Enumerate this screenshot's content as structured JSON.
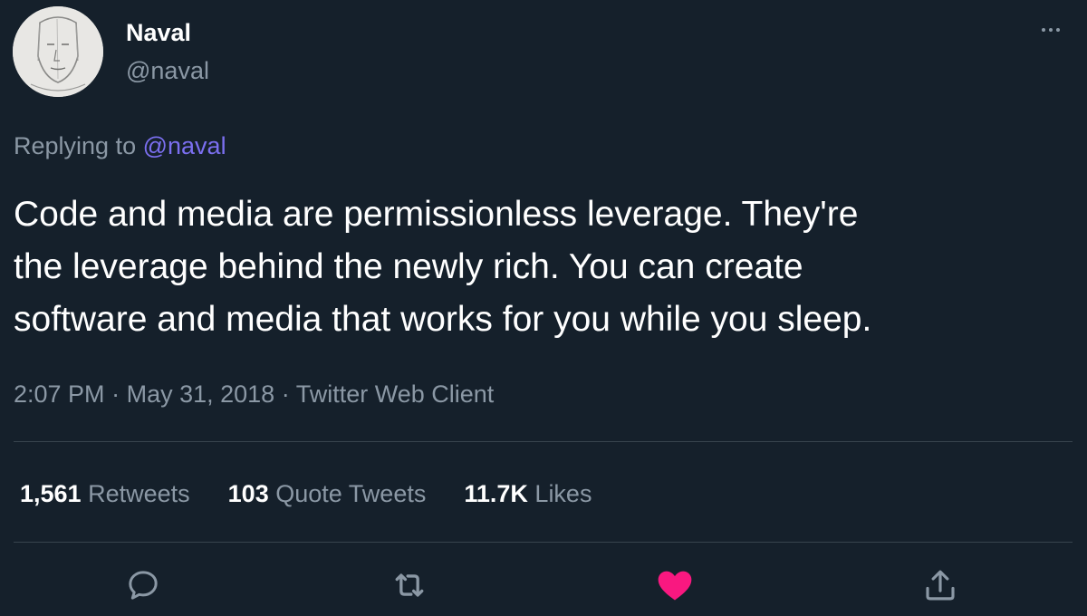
{
  "author": {
    "name": "Naval",
    "handle": "@naval"
  },
  "reply": {
    "prefix": "Replying to",
    "mention": "@naval"
  },
  "tweet": {
    "lines": [
      "Code and media are permissionless leverage. They're",
      "the leverage behind the newly rich. You can create",
      "software and media that works for you while you sleep."
    ],
    "time": "2:07 PM",
    "date": "May 31, 2018",
    "client": "Twitter Web Client",
    "separator": "·"
  },
  "stats": {
    "retweets": {
      "count": "1,561",
      "label": "Retweets"
    },
    "quotes": {
      "count": "103",
      "label": "Quote Tweets"
    },
    "likes": {
      "count": "11.7K",
      "label": "Likes"
    }
  },
  "actions": {
    "reply_icon": "reply-icon",
    "retweet_icon": "retweet-icon",
    "like_icon": "heart-icon",
    "like_state": "liked",
    "share_icon": "share-icon"
  },
  "colors": {
    "background": "#15202b",
    "secondary_text": "#8b98a5",
    "mention": "#7b6ff0",
    "like": "#f91880",
    "divider": "#38444d"
  }
}
